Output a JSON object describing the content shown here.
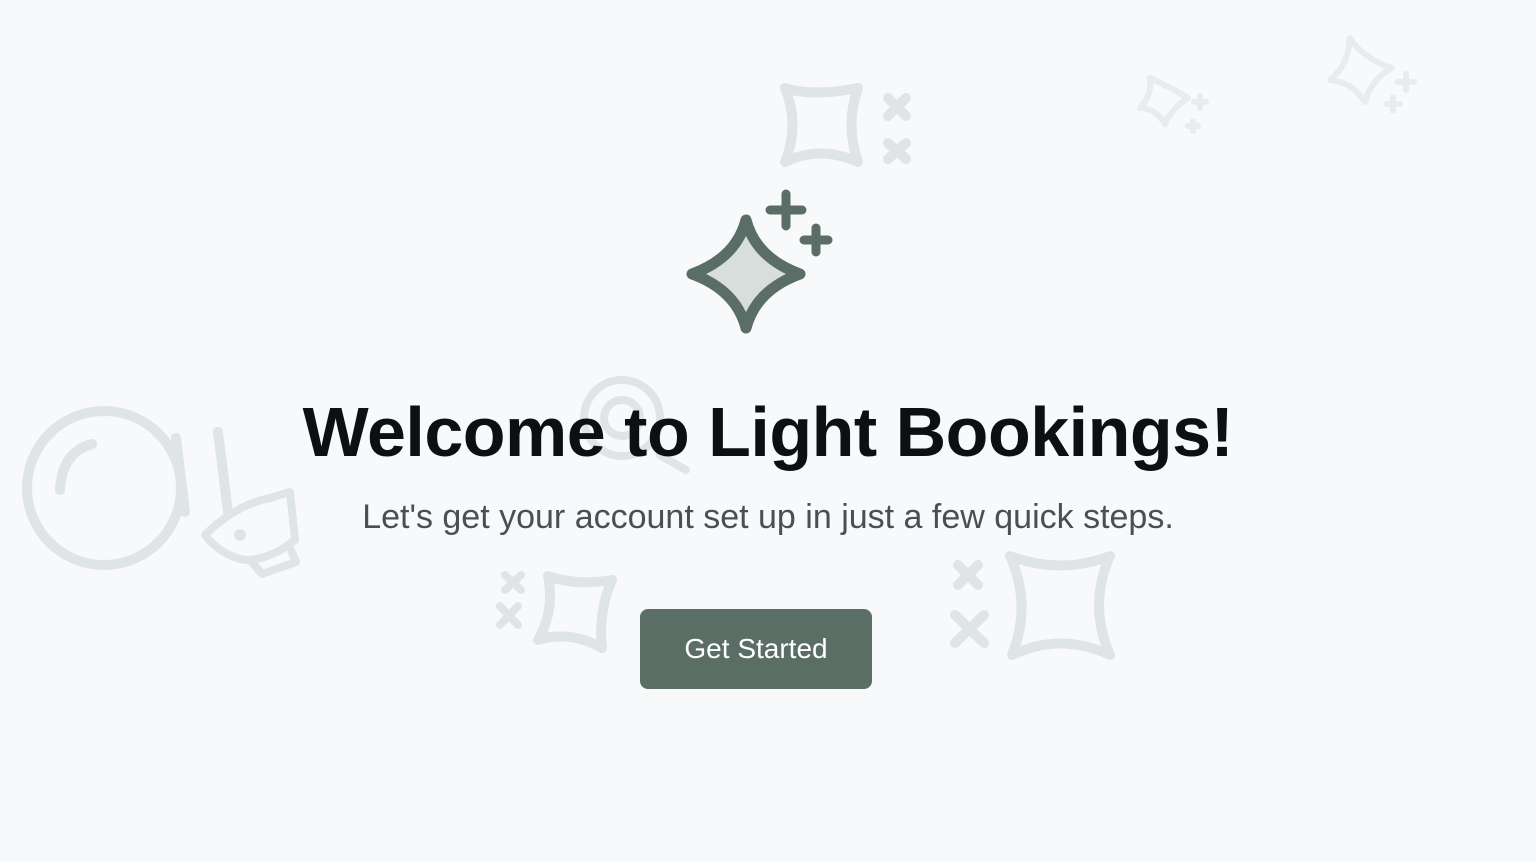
{
  "welcome": {
    "title": "Welcome to Light Bookings!",
    "subtitle": "Let's get your account set up in just a few quick steps.",
    "cta_label": "Get Started"
  },
  "icons": {
    "hero": "sparkles-icon",
    "background": [
      "sparkle-icon",
      "magnifier-icon",
      "rocket-icon",
      "plus-cross-icon"
    ]
  },
  "colors": {
    "background": "#f8f9fa",
    "accent": "#5a6e66",
    "title": "#0d0f10",
    "subtitle": "#4a4f54",
    "decoration": "#dde4e3"
  }
}
